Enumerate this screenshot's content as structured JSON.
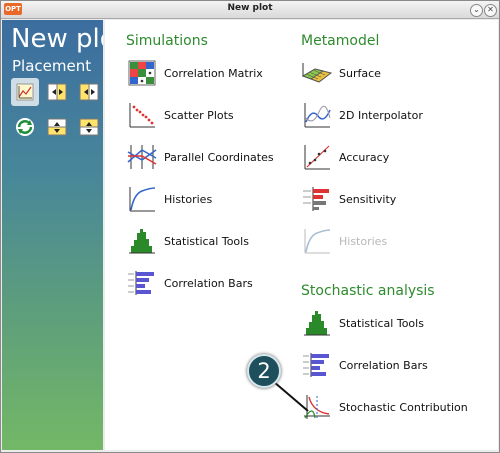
{
  "window": {
    "title": "New plot",
    "app_icon_label": "OPT"
  },
  "sidebar": {
    "title": "New plo",
    "subtitle": "Placement"
  },
  "sections": {
    "simulations": {
      "heading": "Simulations",
      "items": [
        {
          "label": "Correlation Matrix",
          "icon": "correlation-matrix-icon"
        },
        {
          "label": "Scatter Plots",
          "icon": "scatter-plot-icon"
        },
        {
          "label": "Parallel Coordinates",
          "icon": "parallel-coordinates-icon"
        },
        {
          "label": "Histories",
          "icon": "histories-icon"
        },
        {
          "label": "Statistical Tools",
          "icon": "histogram-icon"
        },
        {
          "label": "Correlation Bars",
          "icon": "correlation-bars-icon"
        }
      ]
    },
    "metamodel": {
      "heading": "Metamodel",
      "items": [
        {
          "label": "Surface",
          "icon": "surface-icon"
        },
        {
          "label": "2D Interpolator",
          "icon": "interpolator-icon"
        },
        {
          "label": "Accuracy",
          "icon": "accuracy-icon"
        },
        {
          "label": "Sensitivity",
          "icon": "sensitivity-icon"
        },
        {
          "label": "Histories",
          "icon": "histories-icon",
          "disabled": true
        }
      ]
    },
    "stochastic": {
      "heading": "Stochastic analysis",
      "items": [
        {
          "label": "Statistical Tools",
          "icon": "histogram-icon"
        },
        {
          "label": "Correlation Bars",
          "icon": "correlation-bars-icon"
        },
        {
          "label": "Stochastic Contribution",
          "icon": "stochastic-contribution-icon"
        }
      ]
    }
  },
  "callout": {
    "number": "2"
  },
  "colors": {
    "heading": "#2e8b2e",
    "callout": "#1e4f5c",
    "sidebar_top": "#3c6d9f",
    "sidebar_bottom": "#73b866"
  }
}
